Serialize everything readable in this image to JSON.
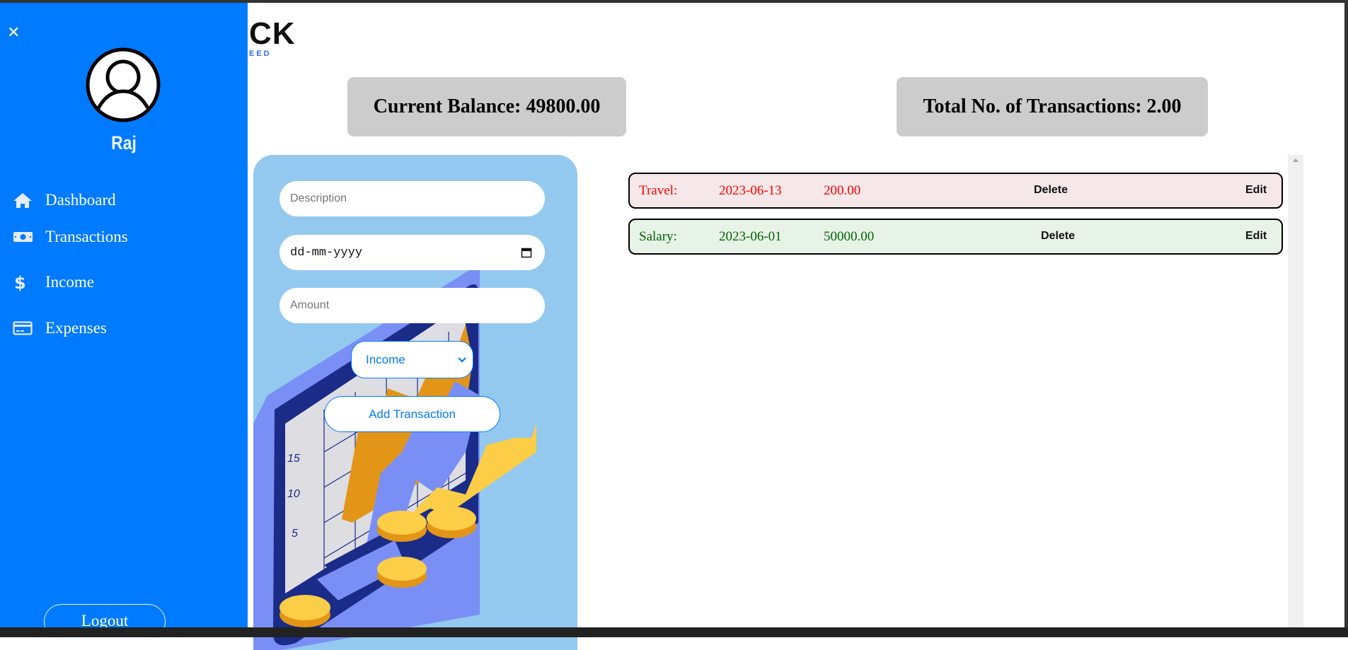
{
  "logo": {
    "text": "CK",
    "tagline": "EED"
  },
  "sidebar": {
    "close_icon": "close-icon",
    "user_name": "Raj",
    "items": [
      {
        "label": "Dashboard",
        "icon": "home-icon"
      },
      {
        "label": "Transactions",
        "icon": "money-bill-icon"
      },
      {
        "label": "Income",
        "icon": "dollar-icon"
      },
      {
        "label": "Expenses",
        "icon": "credit-card-icon"
      }
    ],
    "logout_label": "Logout",
    "color": "#007bff"
  },
  "stats": {
    "balance": "Current Balance: 49800.00",
    "total": "Total No. of Transactions: 2.00"
  },
  "form": {
    "description_placeholder": "Description",
    "date_placeholder": "dd-mm-yyyy",
    "amount_placeholder": "Amount",
    "type_selected": "Income",
    "add_label": "Add Transaction"
  },
  "transactions": [
    {
      "category": "Travel:",
      "date": "2023-06-13",
      "amount": "200.00",
      "delete": "Delete",
      "edit": "Edit",
      "type": "expense",
      "color": "#ff0000",
      "bg": "#f6e8e8"
    },
    {
      "category": "Salary:",
      "date": "2023-06-01",
      "amount": "50000.00",
      "delete": "Delete",
      "edit": "Edit",
      "type": "income",
      "color": "#006400",
      "bg": "#e8f3e8"
    }
  ],
  "illustration": {
    "axis_labels": [
      "15",
      "10",
      "5"
    ]
  }
}
